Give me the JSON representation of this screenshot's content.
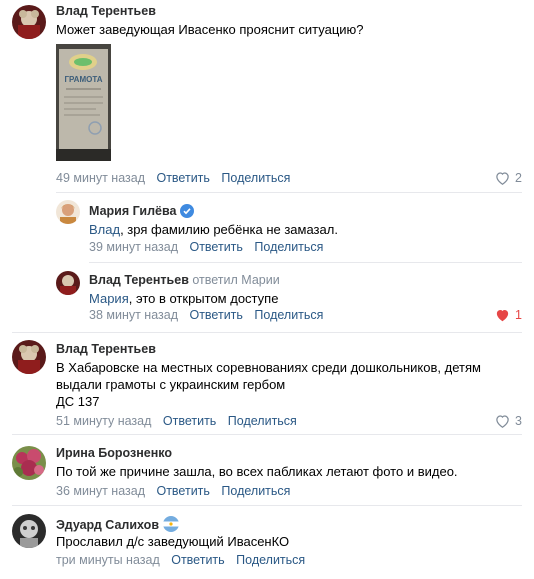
{
  "comments": [
    {
      "author": "Влад Терентьев",
      "text": "Может заведующая Ивасенко прояснит ситуацию?",
      "photo_caption": "ГРАМОТА",
      "time": "49 минут назад",
      "reply": "Ответить",
      "share": "Поделиться",
      "likes": "2"
    },
    {
      "author": "Мария Гилёва",
      "mention": "Влад",
      "text": ", зря фамилию ребёнка не замазал.",
      "time": "39 минут назад",
      "reply": "Ответить",
      "share": "Поделиться"
    },
    {
      "author": "Влад Терентьев",
      "replied_to": "ответил Марии",
      "mention": "Мария",
      "text": ", это в открытом доступе",
      "time": "38 минут назад",
      "reply": "Ответить",
      "share": "Поделиться",
      "likes": "1"
    },
    {
      "author": "Влад Терентьев",
      "text_line1": "В Хабаровске на местных соревнованиях среди дошкольников, детям",
      "text_line2": "выдали грамоты с украинским гербом",
      "text_line3": "ДС 137",
      "time": "51 минуту назад",
      "reply": "Ответить",
      "share": "Поделиться",
      "likes": "3"
    },
    {
      "author": "Ирина Борозненко",
      "text": "По той же причине зашла, во всех пабликах летают фото и видео.",
      "time": "36 минут назад",
      "reply": "Ответить",
      "share": "Поделиться"
    },
    {
      "author": "Эдуард Салихов",
      "text": "Прославил д/с заведующий ИвасенКО",
      "time": "три минуты назад",
      "reply": "Ответить",
      "share": "Поделиться"
    }
  ],
  "colors": {
    "link": "#2a5885",
    "meta": "#818c99",
    "liked": "#e64646",
    "separator": "#e7e8ec"
  }
}
